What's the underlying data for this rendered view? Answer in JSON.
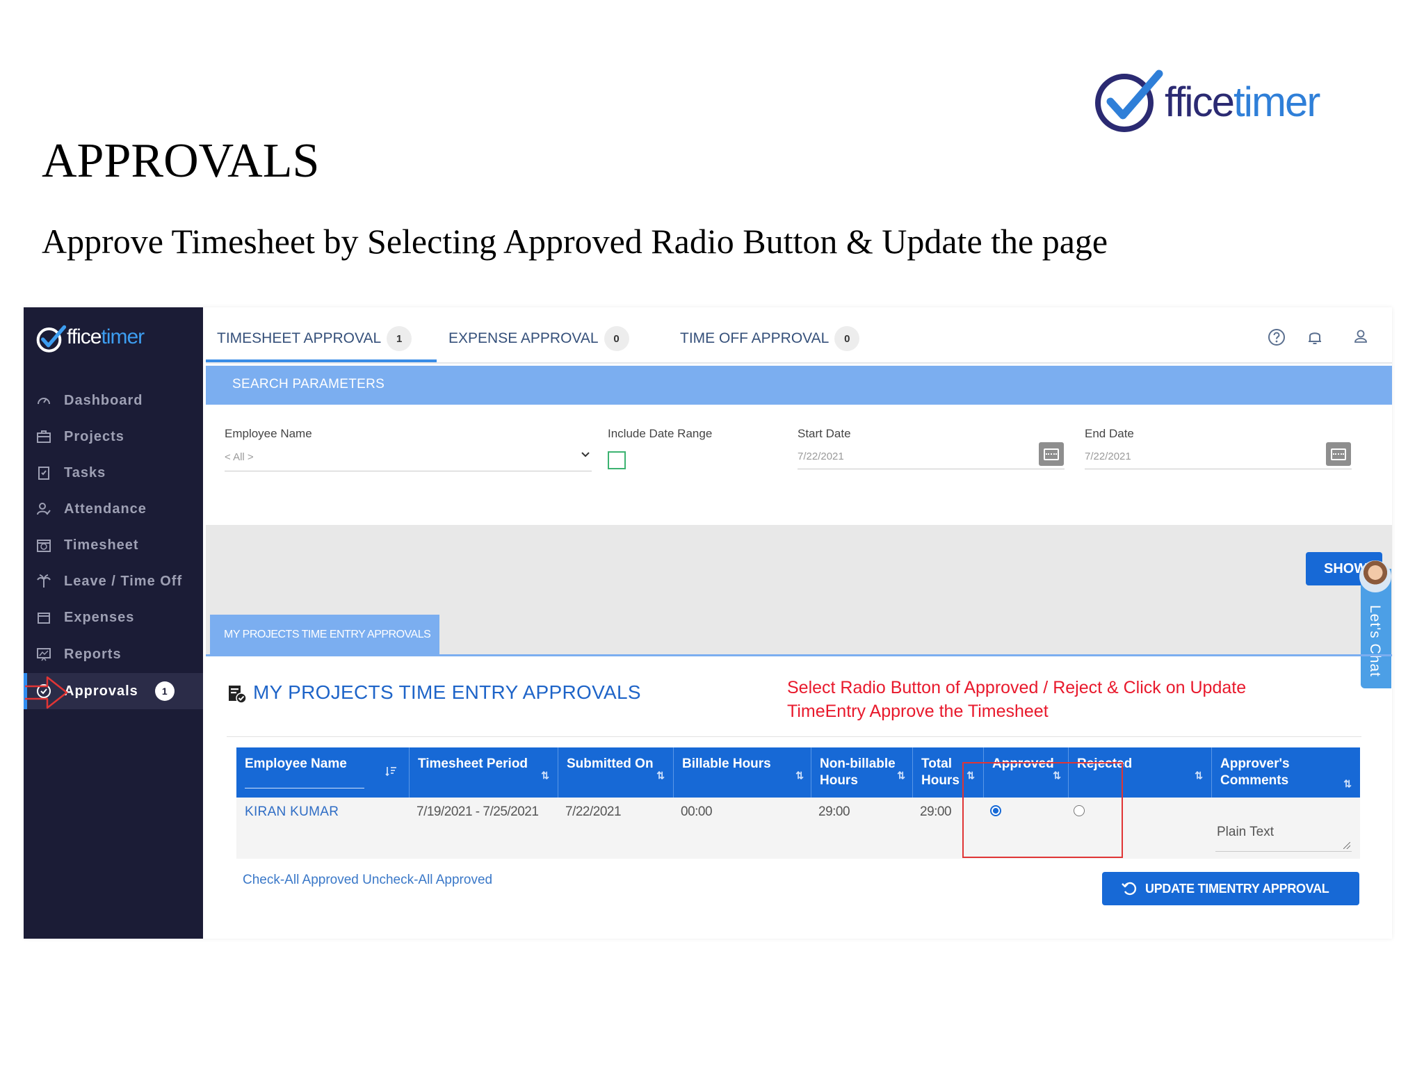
{
  "slide": {
    "title": "APPROVALS",
    "subtitle": "Approve Timesheet by Selecting Approved Radio Button & Update the page",
    "logo_text_a": "ffice",
    "logo_text_b": "timer"
  },
  "sidebar": {
    "logo_text_a": "ffice",
    "logo_text_b": "timer",
    "items": [
      {
        "label": "Dashboard",
        "icon": "gauge-icon"
      },
      {
        "label": "Projects",
        "icon": "briefcase-icon"
      },
      {
        "label": "Tasks",
        "icon": "clipboard-icon"
      },
      {
        "label": "Attendance",
        "icon": "user-check-icon"
      },
      {
        "label": "Timesheet",
        "icon": "calendar-clock-icon"
      },
      {
        "label": "Leave / Time Off",
        "icon": "palm-tree-icon"
      },
      {
        "label": "Expenses",
        "icon": "wallet-icon"
      },
      {
        "label": "Reports",
        "icon": "chart-board-icon"
      },
      {
        "label": "Approvals",
        "icon": "check-circle-icon",
        "badge": "1",
        "active": true
      }
    ]
  },
  "tabs": [
    {
      "label": "TIMESHEET APPROVAL",
      "count": "1",
      "active": true
    },
    {
      "label": "EXPENSE APPROVAL",
      "count": "0"
    },
    {
      "label": "TIME OFF APPROVAL",
      "count": "0"
    }
  ],
  "header_icons": [
    "help-icon",
    "bell-icon",
    "user-icon"
  ],
  "search": {
    "title": "SEARCH PARAMETERS",
    "employee_label": "Employee Name",
    "employee_value": "< All >",
    "include_date_label": "Include Date Range",
    "start_label": "Start Date",
    "start_value": "7/22/2021",
    "end_label": "End Date",
    "end_value": "7/22/2021",
    "show_button": "SHOW"
  },
  "chat": {
    "label": "Let's Chat"
  },
  "subtab": {
    "label": "MY PROJECTS TIME ENTRY APPROVALS"
  },
  "section": {
    "title": "MY PROJECTS TIME ENTRY APPROVALS",
    "instruction_line1": "Select Radio Button of Approved / Reject & Click on Update",
    "instruction_line2": "TimeEntry Approve the Timesheet"
  },
  "table": {
    "headers": {
      "employee": "Employee Name",
      "period": "Timesheet Period",
      "submitted": "Submitted On",
      "billable": "Billable Hours",
      "nonbillable_1": "Non-billable",
      "nonbillable_2": "Hours",
      "total_1": "Total",
      "total_2": "Hours",
      "approved": "Approved",
      "rejected": "Rejected",
      "comments": "Approver's Comments"
    },
    "rows": [
      {
        "employee": "KIRAN KUMAR",
        "period": "7/19/2021 - 7/25/2021",
        "submitted": "7/22/2021",
        "billable": "00:00",
        "nonbillable": "29:00",
        "total": "29:00",
        "approved": true,
        "rejected": false,
        "comment": "Plain Text"
      }
    ]
  },
  "actions": {
    "check_all": "Check-All Approved",
    "uncheck_all": "Uncheck-All Approved",
    "update_button": "UPDATE TIMENTRY APPROVAL"
  },
  "colors": {
    "sidebar_bg": "#1b1c36",
    "primary": "#1769d6",
    "panel_blue": "#7baef0",
    "instruction_red": "#e8192c",
    "brand_dark": "#2b2a72",
    "brand_blue": "#2f7fd8"
  }
}
